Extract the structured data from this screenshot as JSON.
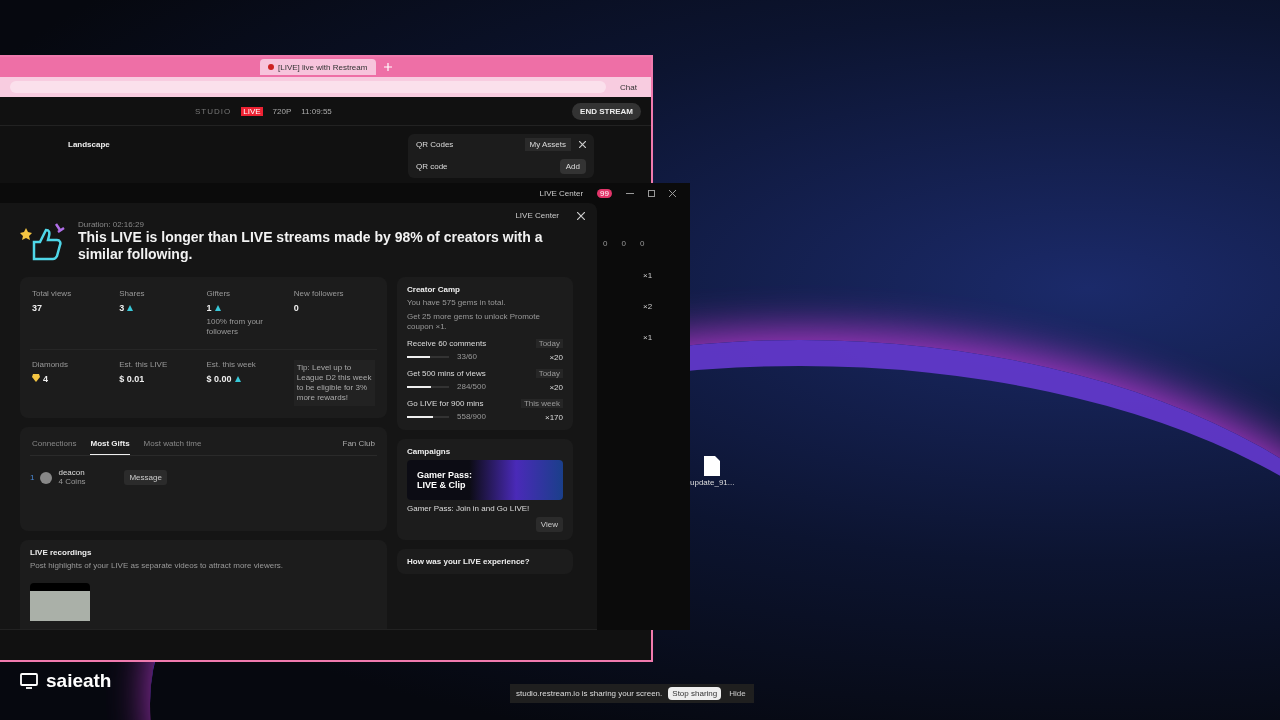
{
  "browser": {
    "tab_title": "[LIVE] live with Restream",
    "toolbar_chat": "Chat",
    "studio_brand": "STUDIO",
    "live_badge": "LIVE",
    "resolution": "720P",
    "timer": "11:09:55",
    "end_stream": "END STREAM",
    "layout": "Landscape",
    "qr_panel": {
      "title": "QR Codes",
      "assets": "My Assets",
      "section": "QR code",
      "add": "Add"
    }
  },
  "live_window": {
    "title_link": "LIVE Center",
    "notification_count": "99",
    "dialog": {
      "header_link": "LIVE Center",
      "duration": "Duration: 02:16:29",
      "headline": "This LIVE is longer than LIVE streams made by 98% of creators with a similar following.",
      "stats": [
        {
          "label": "Total views",
          "value": "37",
          "trend": false
        },
        {
          "label": "Shares",
          "value": "3",
          "trend": true
        },
        {
          "label": "Gifters",
          "value": "1",
          "trend": true,
          "note": "100% from your followers"
        },
        {
          "label": "New followers",
          "value": "0",
          "trend": false
        }
      ],
      "earnings": [
        {
          "label": "Diamonds",
          "value": "4",
          "kind": "diamond"
        },
        {
          "label": "Est. this LIVE",
          "value": "$ 0.01",
          "kind": "plain"
        },
        {
          "label": "Est. this week",
          "value": "$ 0.00",
          "kind": "trend"
        }
      ],
      "tip": "Tip: Level up to League D2 this week to be eligible for 3% more rewards!",
      "tabs": [
        {
          "label": "Connections",
          "selected": false
        },
        {
          "label": "Most Gifts",
          "selected": true
        },
        {
          "label": "Most watch time",
          "selected": false
        }
      ],
      "fan_club": "Fan Club",
      "gifters": [
        {
          "rank": "1",
          "name": "deacon",
          "coins": "4 Coins",
          "action": "Message"
        }
      ],
      "recordings": {
        "title": "LIVE recordings",
        "text": "Post highlights of your LIVE as separate videos to attract more viewers."
      },
      "creator_camp": {
        "title": "Creator Camp",
        "gems": "You have 575 gems in total.",
        "unlock": "Get 25 more gems to unlock Promote coupon ×1.",
        "tasks": [
          {
            "name": "Receive 60 comments",
            "period": "Today",
            "progress": "33/60",
            "level": 0.55,
            "reward": "×20"
          },
          {
            "name": "Get 500 mins of views",
            "period": "Today",
            "progress": "284/500",
            "level": 0.57,
            "reward": "×20"
          },
          {
            "name": "Go LIVE for 900 mins",
            "period": "This week",
            "progress": "558/900",
            "level": 0.62,
            "reward": "×170"
          }
        ]
      },
      "campaigns": {
        "title": "Campaigns",
        "banner_title": "Gamer Pass: LIVE & Clip",
        "caption": "Gamer Pass: Join in and Go LIVE!",
        "action": "View"
      },
      "feedback": "How was your LIVE experience?"
    },
    "side_counts": [
      "0",
      "0",
      "0"
    ],
    "side_gifts": [
      "×1",
      "×2",
      "×1"
    ]
  },
  "desktop_file": "update_91...",
  "share_bar": {
    "text": "studio.restream.io is sharing your screen.",
    "stop": "Stop sharing",
    "hide": "Hide"
  },
  "user": "saieath"
}
